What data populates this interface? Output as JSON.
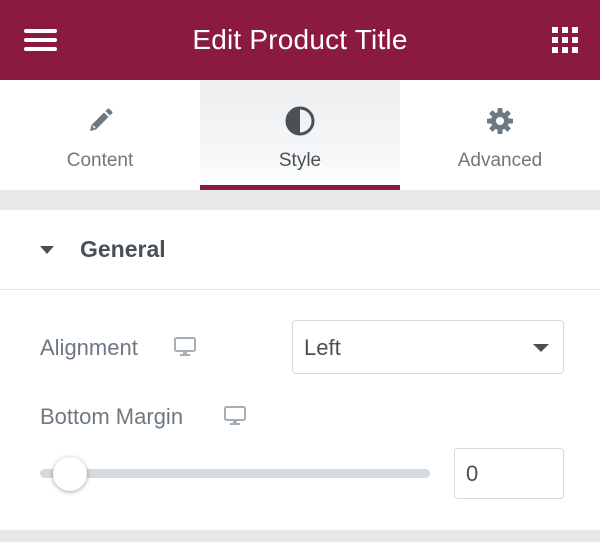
{
  "header": {
    "title": "Edit Product Title",
    "menu_icon": "hamburger-menu-icon",
    "apps_icon": "grid-apps-icon",
    "background": "#8b1a42"
  },
  "tabs": [
    {
      "label": "Content",
      "icon": "pencil-icon",
      "active": false
    },
    {
      "label": "Style",
      "icon": "half-circle-contrast-icon",
      "active": true
    },
    {
      "label": "Advanced",
      "icon": "gear-icon",
      "active": false
    }
  ],
  "section": {
    "title": "General",
    "expanded": true
  },
  "controls": {
    "alignment": {
      "label": "Alignment",
      "icon": "desktop-monitor-icon",
      "value": "Left"
    },
    "bottom_margin": {
      "label": "Bottom Margin",
      "icon": "desktop-monitor-icon",
      "value": "0",
      "slider_fraction": 0
    }
  },
  "colors": {
    "accent": "#8b1a42",
    "text": "#6d7882",
    "heading": "#495157"
  }
}
